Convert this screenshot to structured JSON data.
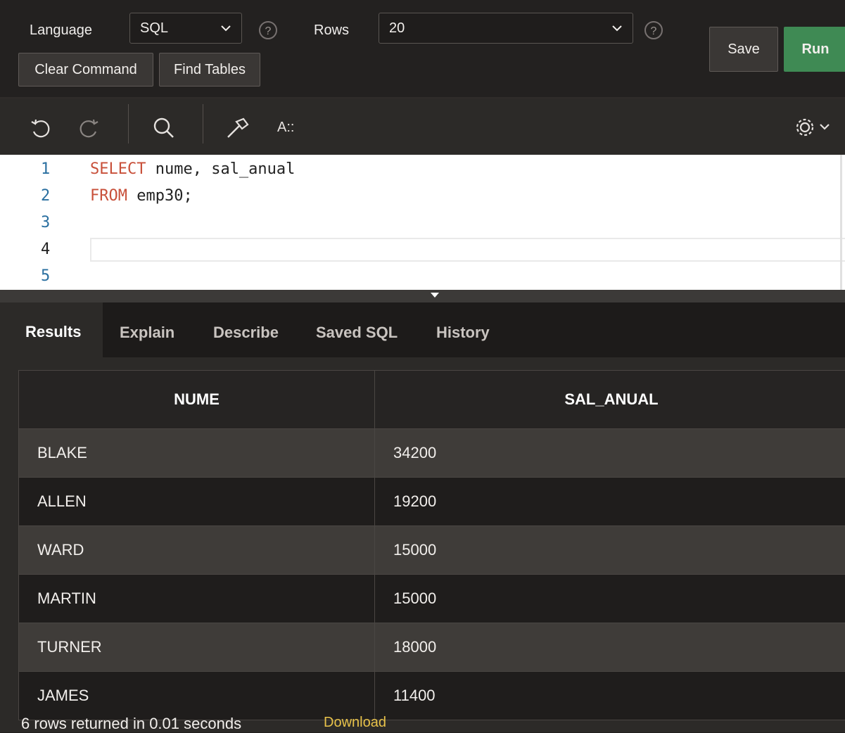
{
  "toolbar": {
    "language_label": "Language",
    "language_value": "SQL",
    "rows_label": "Rows",
    "rows_value": "20",
    "help_glyph": "?",
    "clear_command_label": "Clear Command",
    "find_tables_label": "Find Tables",
    "save_label": "Save",
    "run_label": "Run"
  },
  "editor_toolbar": {
    "undo_icon": "undo-icon",
    "redo_icon": "redo-icon",
    "search_icon": "search-icon",
    "format_icon": "hammer-icon",
    "autocomplete_label": "A::",
    "settings_icon": "gear-icon"
  },
  "editor": {
    "line_numbers": [
      "1",
      "2",
      "3",
      "4",
      "5"
    ],
    "line1_keyword": "SELECT",
    "line1_rest": " nume, sal_anual",
    "line2_keyword": "FROM",
    "line2_rest": " emp30;"
  },
  "tabs": {
    "results": "Results",
    "explain": "Explain",
    "describe": "Describe",
    "saved_sql": "Saved SQL",
    "history": "History"
  },
  "results_table": {
    "columns": [
      "NUME",
      "SAL_ANUAL"
    ],
    "rows": [
      [
        "BLAKE",
        "34200"
      ],
      [
        "ALLEN",
        "19200"
      ],
      [
        "WARD",
        "15000"
      ],
      [
        "MARTIN",
        "15000"
      ],
      [
        "TURNER",
        "18000"
      ],
      [
        "JAMES",
        "11400"
      ]
    ]
  },
  "footer": {
    "status": "6 rows returned in 0.01 seconds",
    "download_label": "Download"
  },
  "colors": {
    "run_button": "#3f8a54",
    "keyword": "#c8503a",
    "download_link": "#e8c24a"
  }
}
